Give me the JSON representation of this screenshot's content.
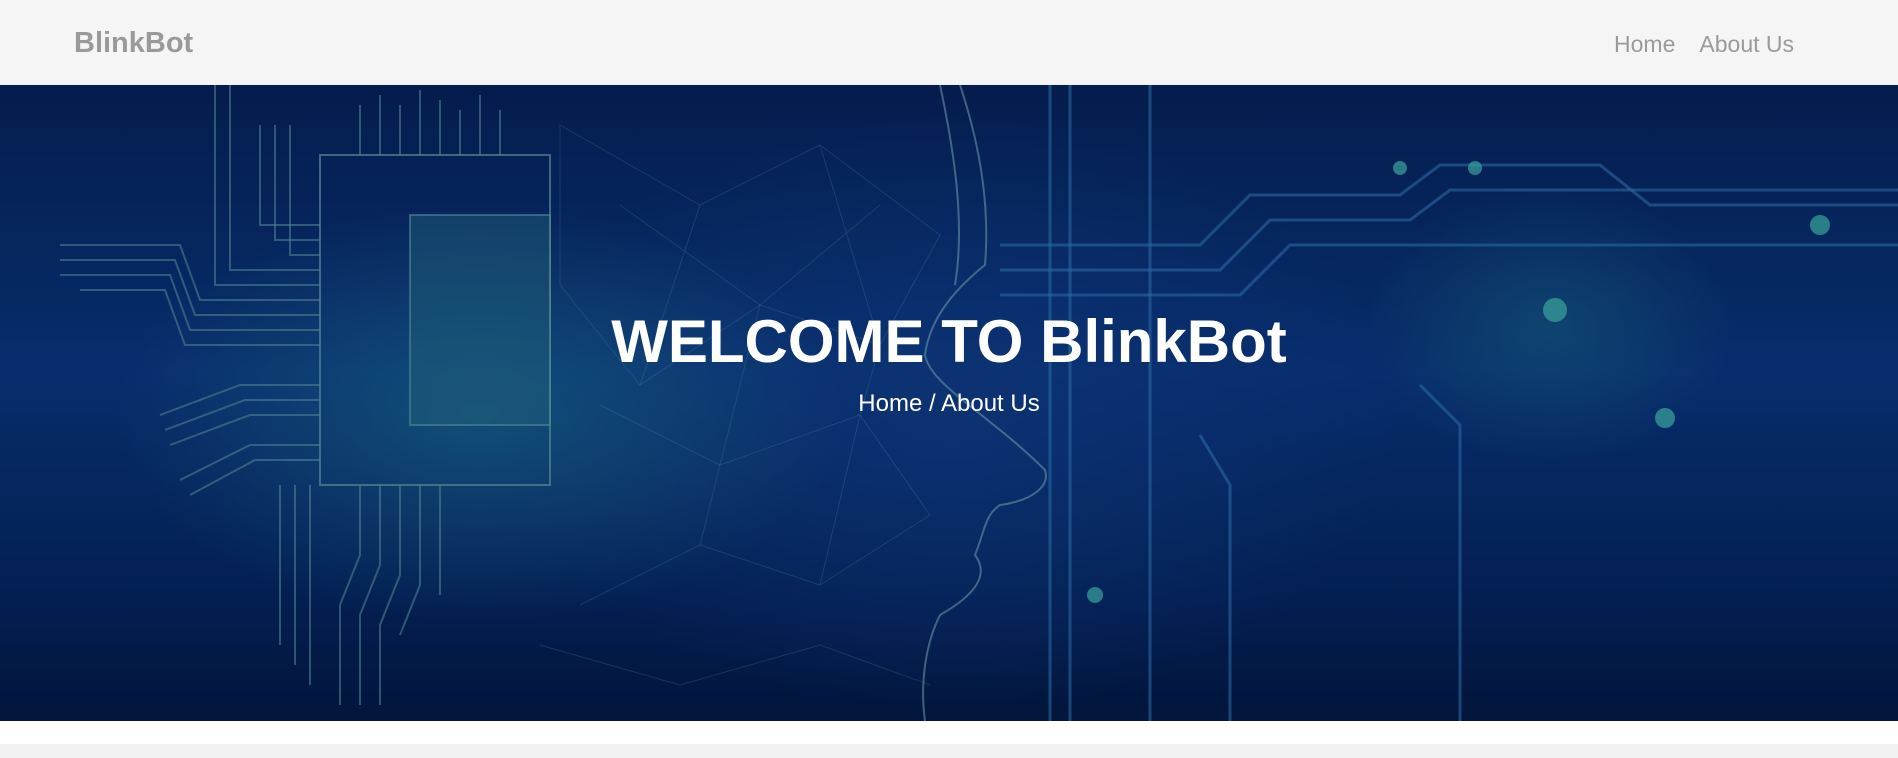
{
  "navbar": {
    "brand": "BlinkBot",
    "links": [
      {
        "label": "Home"
      },
      {
        "label": "About Us"
      }
    ]
  },
  "hero": {
    "title": "WELCOME TO BlinkBot",
    "breadcrumb": {
      "home": "Home",
      "separator": "/",
      "current": "About Us"
    },
    "background_colors": {
      "deep": "#031a45",
      "mid": "#0a3a86",
      "glow": "#2a8ca8"
    }
  }
}
